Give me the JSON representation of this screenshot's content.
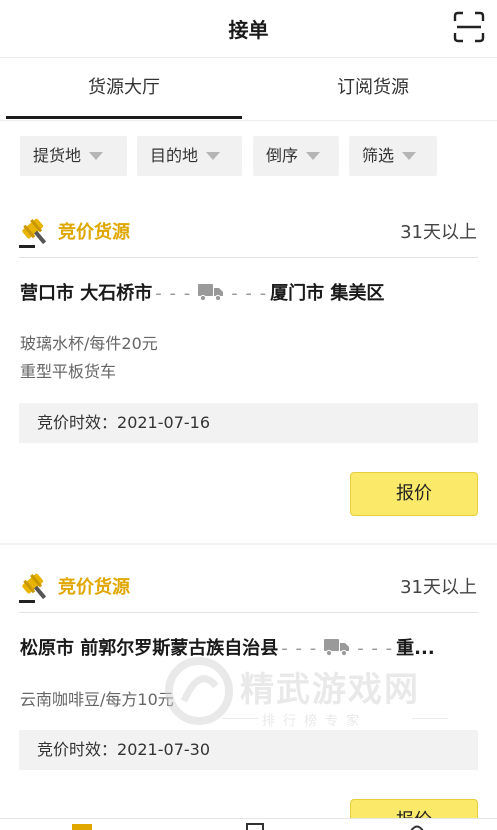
{
  "header": {
    "title": "接单",
    "scan_icon": "scan-icon"
  },
  "tabs": [
    {
      "label": "货源大厅",
      "active": true
    },
    {
      "label": "订阅货源",
      "active": false
    }
  ],
  "filters": [
    {
      "label": "提货地"
    },
    {
      "label": "目的地"
    },
    {
      "label": "倒序"
    },
    {
      "label": "筛选"
    }
  ],
  "cards": [
    {
      "badge": "竞价货源",
      "time_range": "31天以上",
      "origin": "营口市 大石桥市",
      "dash": "- - -",
      "destination": "厦门市 集美区",
      "goods": "玻璃水杯/每件20元",
      "vehicle": "重型平板货车",
      "bid_prefix": "竞价时效：",
      "bid_date": "2021-07-16",
      "quote_label": "报价"
    },
    {
      "badge": "竞价货源",
      "time_range": "31天以上",
      "origin": "松原市 前郭尔罗斯蒙古族自治县",
      "dash": "- - -",
      "destination": "重...",
      "goods": "云南咖啡豆/每方10元",
      "bid_prefix": "竞价时效：",
      "bid_date": "2021-07-30",
      "quote_label": "报价"
    }
  ],
  "watermark": {
    "title": "精武游戏网",
    "subtitle": "排行榜专家"
  },
  "colors": {
    "accent": "#e0a700",
    "button": "#fbe96a",
    "background": "#f2f2f2"
  }
}
